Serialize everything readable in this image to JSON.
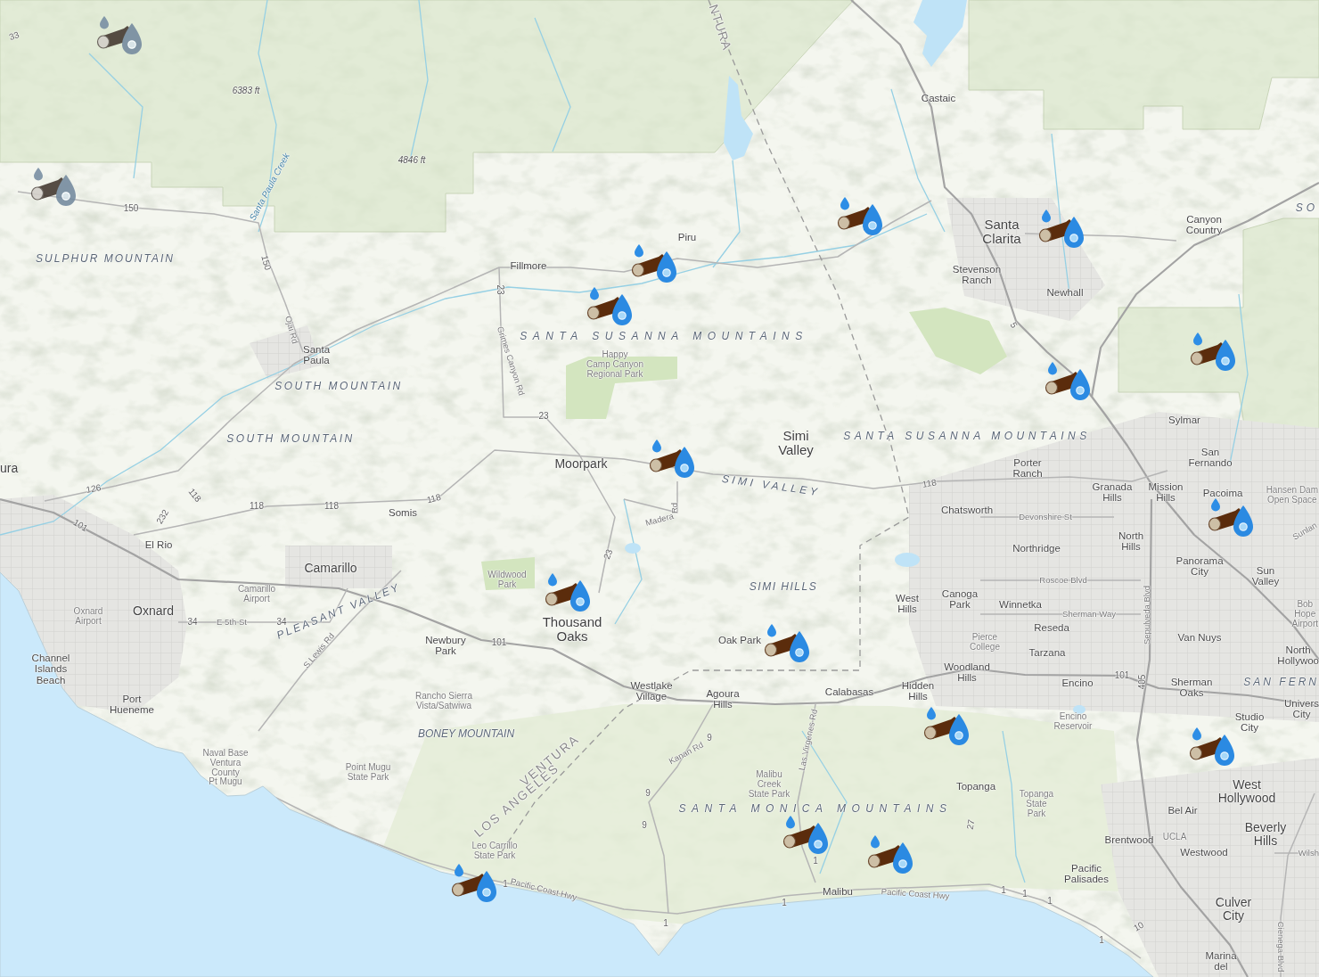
{
  "map": {
    "labels": [
      {
        "text": "33",
        "kind": "route"
      },
      {
        "text": "NTURA",
        "kind": "county"
      },
      {
        "text": "6383 ft",
        "kind": "elevation"
      },
      {
        "text": "Castaic",
        "kind": "city"
      },
      {
        "text": "Santa Paula Creek",
        "kind": "water"
      },
      {
        "text": "4846 ft",
        "kind": "elevation"
      },
      {
        "text": "150",
        "kind": "route"
      },
      {
        "text": "SO",
        "kind": "terrain"
      },
      {
        "text": "Piru",
        "kind": "city"
      },
      {
        "text": "Santa\nClarita",
        "kind": "city_large"
      },
      {
        "text": "Canyon\nCountry",
        "kind": "city"
      },
      {
        "text": "SULPHUR MOUNTAIN",
        "kind": "terrain"
      },
      {
        "text": "150",
        "kind": "route"
      },
      {
        "text": "Fillmore",
        "kind": "city"
      },
      {
        "text": "23",
        "kind": "route"
      },
      {
        "text": "Stevenson\nRanch",
        "kind": "city"
      },
      {
        "text": "Newhall",
        "kind": "city"
      },
      {
        "text": "Ojai Rd",
        "kind": "street"
      },
      {
        "text": "SANTA SUSANNA MOUNTAINS",
        "kind": "terrain"
      },
      {
        "text": "5",
        "kind": "route"
      },
      {
        "text": "Santa\nPaula",
        "kind": "city"
      },
      {
        "text": "Grimes Canyon Rd",
        "kind": "street"
      },
      {
        "text": "Happy\nCamp Canyon\nRegional Park",
        "kind": "park"
      },
      {
        "text": "SOUTH MOUNTAIN",
        "kind": "terrain"
      },
      {
        "text": "23",
        "kind": "route"
      },
      {
        "text": "Sylmar",
        "kind": "city"
      },
      {
        "text": "SOUTH MOUNTAIN",
        "kind": "terrain"
      },
      {
        "text": "Simi\nValley",
        "kind": "city_large"
      },
      {
        "text": "SANTA SUSANNA MOUNTAINS",
        "kind": "terrain"
      },
      {
        "text": "ura",
        "kind": "city_medium"
      },
      {
        "text": "Moorpark",
        "kind": "city_medium"
      },
      {
        "text": "Porter\nRanch",
        "kind": "city"
      },
      {
        "text": "San\nFernando",
        "kind": "city"
      },
      {
        "text": "126",
        "kind": "route"
      },
      {
        "text": "118",
        "kind": "route"
      },
      {
        "text": "118",
        "kind": "route"
      },
      {
        "text": "SIMI VALLEY",
        "kind": "terrain"
      },
      {
        "text": "118",
        "kind": "route"
      },
      {
        "text": "Granada\nHills",
        "kind": "city"
      },
      {
        "text": "Mission\nHills",
        "kind": "city"
      },
      {
        "text": "Pacoima",
        "kind": "city"
      },
      {
        "text": "Hansen Dam\nOpen Space",
        "kind": "park"
      },
      {
        "text": "232",
        "kind": "route"
      },
      {
        "text": "118",
        "kind": "route"
      },
      {
        "text": "118",
        "kind": "route"
      },
      {
        "text": "Somis",
        "kind": "city"
      },
      {
        "text": "Madera",
        "kind": "street"
      },
      {
        "text": "Rd",
        "kind": "street"
      },
      {
        "text": "Chatsworth",
        "kind": "city"
      },
      {
        "text": "Devonshire St",
        "kind": "street"
      },
      {
        "text": "101",
        "kind": "route"
      },
      {
        "text": "El Rio",
        "kind": "city"
      },
      {
        "text": "23",
        "kind": "route"
      },
      {
        "text": "Northridge",
        "kind": "city"
      },
      {
        "text": "North\nHills",
        "kind": "city"
      },
      {
        "text": "Sunlan",
        "kind": "street"
      },
      {
        "text": "Camarillo",
        "kind": "city_medium"
      },
      {
        "text": "Wildwood\nPark",
        "kind": "park"
      },
      {
        "text": "SIMI HILLS",
        "kind": "terrain"
      },
      {
        "text": "Roscoe Blvd",
        "kind": "street"
      },
      {
        "text": "Panorama\nCity",
        "kind": "city"
      },
      {
        "text": "Sun\nValley",
        "kind": "city"
      },
      {
        "text": "Camarillo\nAirport",
        "kind": "park"
      },
      {
        "text": "West\nHills",
        "kind": "city"
      },
      {
        "text": "Canoga\nPark",
        "kind": "city"
      },
      {
        "text": "Winnetka",
        "kind": "city"
      },
      {
        "text": "Oxnard\nAirport",
        "kind": "park"
      },
      {
        "text": "Oxnard",
        "kind": "city_medium"
      },
      {
        "text": "34",
        "kind": "route"
      },
      {
        "text": "E 5th St",
        "kind": "street"
      },
      {
        "text": "34",
        "kind": "route"
      },
      {
        "text": "PLEASANT VALLEY",
        "kind": "terrain"
      },
      {
        "text": "Thousand\nOaks",
        "kind": "city_large"
      },
      {
        "text": "Reseda",
        "kind": "city"
      },
      {
        "text": "Sherman Way",
        "kind": "street"
      },
      {
        "text": "Sepulveda Blvd",
        "kind": "street"
      },
      {
        "text": "Bob\nHope\nAirport",
        "kind": "park"
      },
      {
        "text": "Channel\nIslands\nBeach",
        "kind": "city"
      },
      {
        "text": "S Lewis Rd",
        "kind": "street"
      },
      {
        "text": "Newbury\nPark",
        "kind": "city"
      },
      {
        "text": "101",
        "kind": "route"
      },
      {
        "text": "Oak Park",
        "kind": "city"
      },
      {
        "text": "Pierce\nCollege",
        "kind": "park"
      },
      {
        "text": "Tarzana",
        "kind": "city"
      },
      {
        "text": "Van Nuys",
        "kind": "city"
      },
      {
        "text": "North\nHollywoo",
        "kind": "city"
      },
      {
        "text": "Westlake\nVillage",
        "kind": "city"
      },
      {
        "text": "Calabasas",
        "kind": "city"
      },
      {
        "text": "Hidden\nHills",
        "kind": "city"
      },
      {
        "text": "Woodland\nHills",
        "kind": "city"
      },
      {
        "text": "Encino",
        "kind": "city"
      },
      {
        "text": "101",
        "kind": "route"
      },
      {
        "text": "405",
        "kind": "route"
      },
      {
        "text": "Sherman\nOaks",
        "kind": "city"
      },
      {
        "text": "SAN FERN",
        "kind": "terrain"
      },
      {
        "text": "Port\nHueneme",
        "kind": "city"
      },
      {
        "text": "Rancho Sierra\nVista/Satwiwa",
        "kind": "park"
      },
      {
        "text": "Agoura\nHills",
        "kind": "city"
      },
      {
        "text": "Encino\nReservoir",
        "kind": "park"
      },
      {
        "text": "Studio\nCity",
        "kind": "city"
      },
      {
        "text": "Univers\nCity",
        "kind": "city"
      },
      {
        "text": "Naval Base\nVentura\nCounty\nPt Mugu",
        "kind": "park"
      },
      {
        "text": "Point Mugu\nState Park",
        "kind": "park"
      },
      {
        "text": "BONEY MOUNTAIN",
        "kind": "terrain"
      },
      {
        "text": "LOS ANGELES",
        "kind": "county"
      },
      {
        "text": "VENTURA",
        "kind": "county"
      },
      {
        "text": "9",
        "kind": "route"
      },
      {
        "text": "Kanan Rd",
        "kind": "street"
      },
      {
        "text": "9",
        "kind": "route"
      },
      {
        "text": "Malibu\nCreek\nState Park",
        "kind": "park"
      },
      {
        "text": "Las Virgenes Rd",
        "kind": "street"
      },
      {
        "text": "Topanga",
        "kind": "city"
      },
      {
        "text": "West\nHollywood",
        "kind": "city_medium"
      },
      {
        "text": "SANTA MONICA MOUNTAINS",
        "kind": "terrain"
      },
      {
        "text": "Topanga\nState\nPark",
        "kind": "park"
      },
      {
        "text": "Bel Air",
        "kind": "city"
      },
      {
        "text": "9",
        "kind": "route"
      },
      {
        "text": "27",
        "kind": "route"
      },
      {
        "text": "Leo Carrillo\nState Park",
        "kind": "park"
      },
      {
        "text": "1",
        "kind": "route"
      },
      {
        "text": "Brentwood",
        "kind": "city"
      },
      {
        "text": "UCLA",
        "kind": "park"
      },
      {
        "text": "Beverly\nHills",
        "kind": "city_medium"
      },
      {
        "text": "Westwood",
        "kind": "city"
      },
      {
        "text": "Wilsh",
        "kind": "street"
      },
      {
        "text": "1",
        "kind": "route"
      },
      {
        "text": "Pacific Coast Hwy",
        "kind": "street"
      },
      {
        "text": "Pacific\nPalisades",
        "kind": "city"
      },
      {
        "text": "Malibu",
        "kind": "city"
      },
      {
        "text": "1",
        "kind": "route"
      },
      {
        "text": "Pacific Coast Hwy",
        "kind": "street"
      },
      {
        "text": "1",
        "kind": "route"
      },
      {
        "text": "1",
        "kind": "route"
      },
      {
        "text": "1",
        "kind": "route"
      },
      {
        "text": "1",
        "kind": "route"
      },
      {
        "text": "10",
        "kind": "route"
      },
      {
        "text": "Culver\nCity",
        "kind": "city_medium"
      },
      {
        "text": "1",
        "kind": "route"
      },
      {
        "text": "Marina\ndel",
        "kind": "city"
      },
      {
        "text": "Cienega Blvd",
        "kind": "street"
      }
    ],
    "markers": [
      {
        "dimmed": true
      },
      {
        "dimmed": true
      },
      {
        "dimmed": false
      },
      {
        "dimmed": false
      },
      {
        "dimmed": false
      },
      {
        "dimmed": false
      },
      {
        "dimmed": false
      },
      {
        "dimmed": false
      },
      {
        "dimmed": false
      },
      {
        "dimmed": false
      },
      {
        "dimmed": false
      },
      {
        "dimmed": false
      },
      {
        "dimmed": false
      },
      {
        "dimmed": false
      },
      {
        "dimmed": false
      },
      {
        "dimmed": false
      },
      {
        "dimmed": false
      }
    ]
  }
}
